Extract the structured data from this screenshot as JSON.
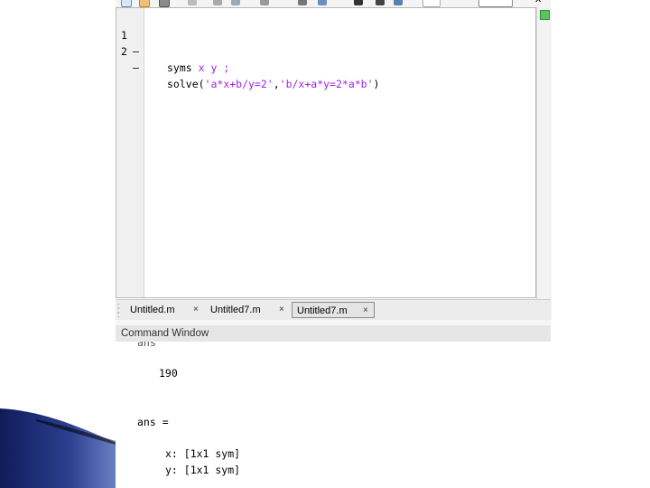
{
  "editor": {
    "lines": [
      {
        "number": "1",
        "marker": "–",
        "keyword": "syms",
        "rest": " x y ;"
      },
      {
        "number": "2",
        "marker": "–",
        "keyword": "solve(",
        "arg1": "'a*x+b/y=2'",
        "comma": ",",
        "arg2": "'b/x+a*y=2*a*b'",
        "close": ")"
      }
    ]
  },
  "tabs": [
    {
      "label": "Untitled.m",
      "close": "×"
    },
    {
      "label": "Untitled7.m",
      "close": "×"
    },
    {
      "label": "Untitled7.m",
      "close": "×",
      "active": true
    }
  ],
  "command_window": {
    "title": "Command Window",
    "partial_top": "ans",
    "value_190": "190",
    "ans_label": "ans =",
    "x_line": "x: [1x1 sym]",
    "y_line": "y: [1x1 sym]"
  },
  "colors": {
    "string": "#a020f0",
    "indicator": "#5cc45c",
    "deco_dark": "#1b2a6b"
  }
}
